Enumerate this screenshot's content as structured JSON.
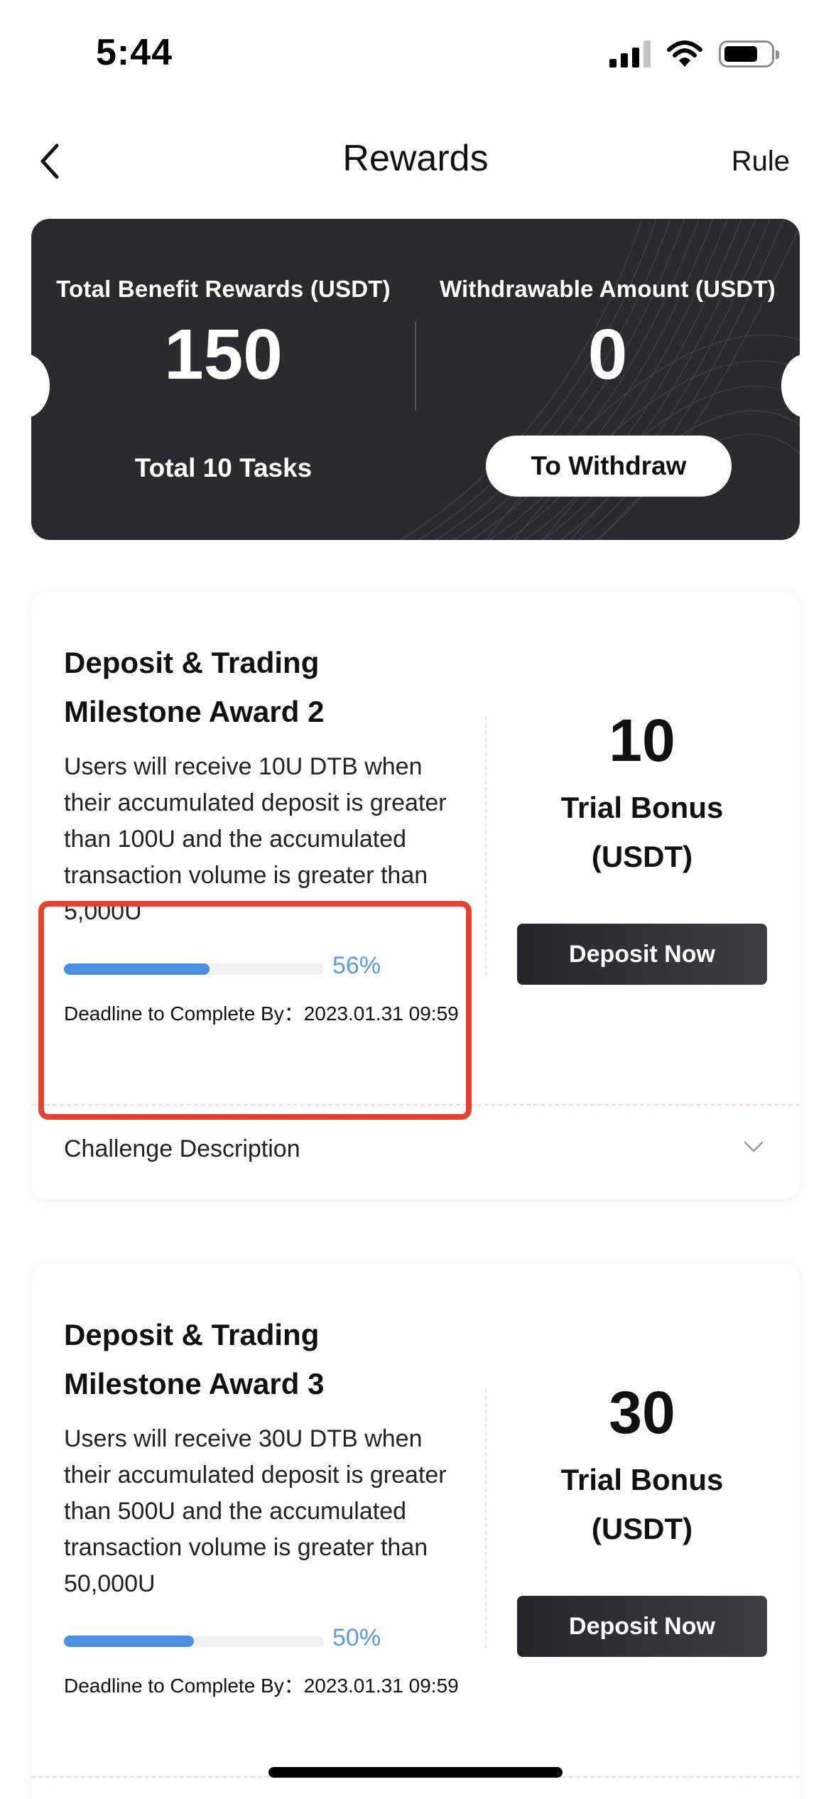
{
  "status_bar": {
    "time": "5:44",
    "icons": [
      "cellular-signal-icon",
      "wifi-icon",
      "battery-icon"
    ]
  },
  "nav": {
    "back_icon": "chevron-left-icon",
    "title": "Rewards",
    "rule_label": "Rule"
  },
  "summary": {
    "total_benefit_label": "Total Benefit Rewards (USDT)",
    "total_benefit_value": "150",
    "withdrawable_label": "Withdrawable Amount (USDT)",
    "withdrawable_value": "0",
    "tasks_label": "Total 10 Tasks",
    "withdraw_button": "To Withdraw"
  },
  "tasks": [
    {
      "title": "Deposit & Trading Milestone Award 2",
      "description": "Users will receive 10U DTB when their accumulated deposit is greater than 100U and the accumulated transaction volume is greater than 5,000U",
      "progress": 0.56,
      "progress_label": "56%",
      "deadline": "Deadline to Complete By：2023.01.31 09:59",
      "reward_amount": "10",
      "reward_label": "Trial Bonus (USDT)",
      "deposit_button": "Deposit Now",
      "challenge_label": "Challenge Description"
    },
    {
      "title": "Deposit & Trading Milestone Award 3",
      "description": "Users will receive 30U DTB when their accumulated deposit is greater than 500U and the accumulated transaction volume is greater than 50,000U",
      "progress": 0.5,
      "progress_label": "50%",
      "deadline": "Deadline to Complete By：2023.01.31 09:59",
      "reward_amount": "30",
      "reward_label": "Trial Bonus (USDT)",
      "deposit_button": "Deposit Now"
    }
  ],
  "colors": {
    "progress": "#4a90e2",
    "hero_background": "#2b2b2e",
    "highlight": "#e5432f"
  }
}
